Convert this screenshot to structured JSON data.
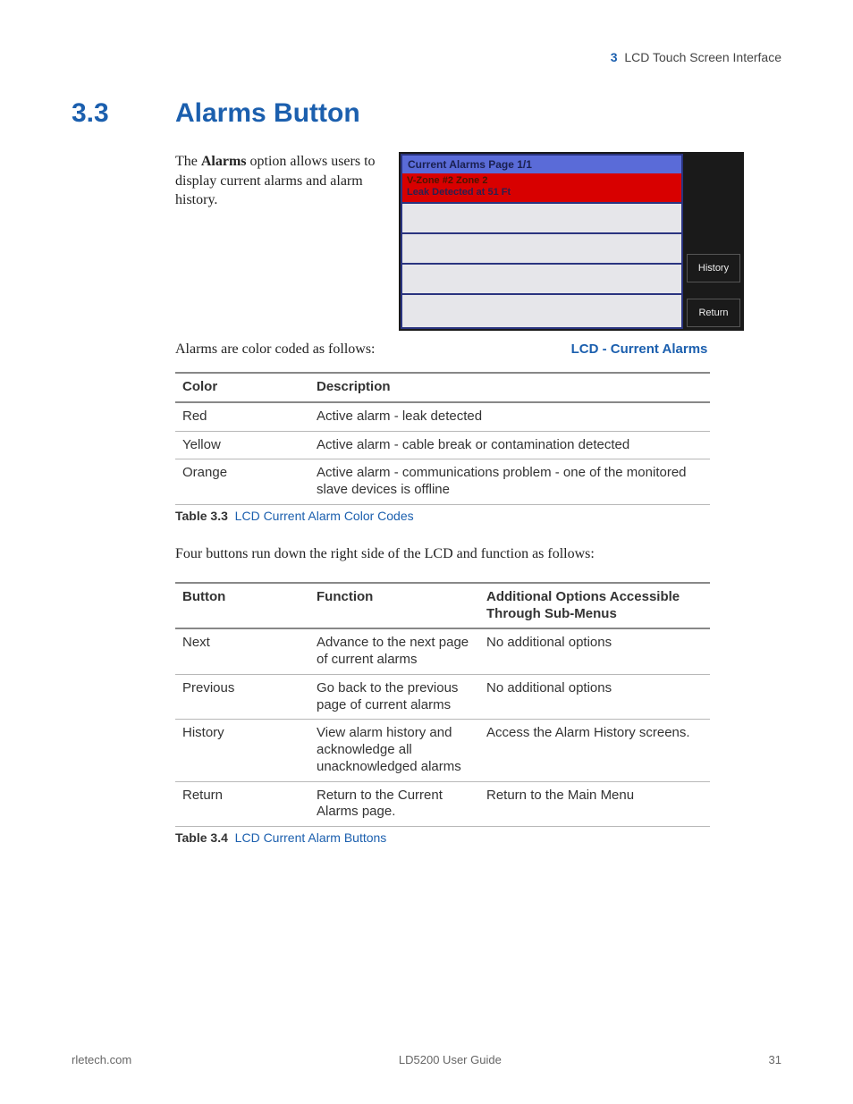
{
  "header": {
    "chapter_num": "3",
    "chapter_title": "LCD Touch Screen Interface"
  },
  "section": {
    "number": "3.3",
    "title": "Alarms Button"
  },
  "intro": {
    "pre": "The ",
    "bold": "Alarms",
    "post": " option allows users to display current alarms and alarm history."
  },
  "lcd": {
    "title": "Current Alarms Page 1/1",
    "alarm_line1": "V-Zone #2 Zone 2",
    "alarm_line2": "Leak Detected at 51 Ft",
    "btn_history": "History",
    "btn_return": "Return",
    "caption": "LCD - Current Alarms"
  },
  "color_coded_text": "Alarms are color coded as follows:",
  "table3": {
    "headers": [
      "Color",
      "Description"
    ],
    "rows": [
      [
        "Red",
        "Active alarm - leak detected"
      ],
      [
        "Yellow",
        "Active alarm - cable break or contamination detected"
      ],
      [
        "Orange",
        "Active alarm - communications problem - one of the monitored slave devices is offline"
      ]
    ],
    "caption_bold": "Table 3.3",
    "caption_blue": "LCD Current Alarm Color Codes"
  },
  "mid_para": "Four buttons run down the right side of the LCD and function as follows:",
  "table4": {
    "headers": [
      "Button",
      "Function",
      "Additional Options Accessible Through Sub-Menus"
    ],
    "rows": [
      [
        "Next",
        "Advance to the next page of current alarms",
        "No additional options"
      ],
      [
        "Previous",
        "Go back to the previous page of current alarms",
        "No additional options"
      ],
      [
        "History",
        "View alarm history and acknowledge all unacknowledged alarms",
        "Access the Alarm History screens."
      ],
      [
        "Return",
        "Return to the Current Alarms page.",
        "Return to the Main Menu"
      ]
    ],
    "caption_bold": "Table 3.4",
    "caption_blue": "LCD Current Alarm Buttons"
  },
  "footer": {
    "left": "rletech.com",
    "center": "LD5200 User Guide",
    "right": "31"
  }
}
